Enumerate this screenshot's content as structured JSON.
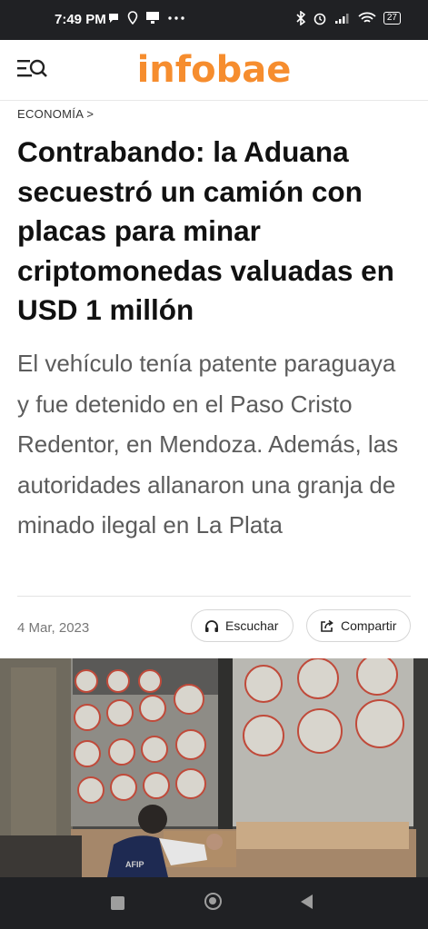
{
  "status_bar": {
    "time": "7:49 PM",
    "left_icons": [
      "chat-bubble-icon",
      "location-icon",
      "cast-icon",
      "more-icon"
    ],
    "right_icons": [
      "bluetooth-icon",
      "alarm-icon",
      "signal-icon",
      "wifi-icon"
    ],
    "battery": "27"
  },
  "header": {
    "logo": "infobae",
    "logo_color": "#f68d2e",
    "menu_icon": "menu-search-icon"
  },
  "article": {
    "section": "ECONOMÍA",
    "section_arrow": ">",
    "title": "Contrabando: la Aduana secuestró un camión con placas para minar criptomonedas valuadas en USD 1 millón",
    "subtitle": "El vehículo tenía patente paraguaya y fue detenido en el Paso Cristo Redentor, en Mendoza. Además, las autoridades allanaron una granja de minado ilegal en La Plata",
    "date": "4 Mar, 2023",
    "listen_label": "Escuchar",
    "share_label": "Compartir",
    "photo_text": "AFIP"
  },
  "nav_bar": {
    "buttons": [
      "recents-square-icon",
      "home-circle-icon",
      "back-triangle-icon"
    ]
  }
}
